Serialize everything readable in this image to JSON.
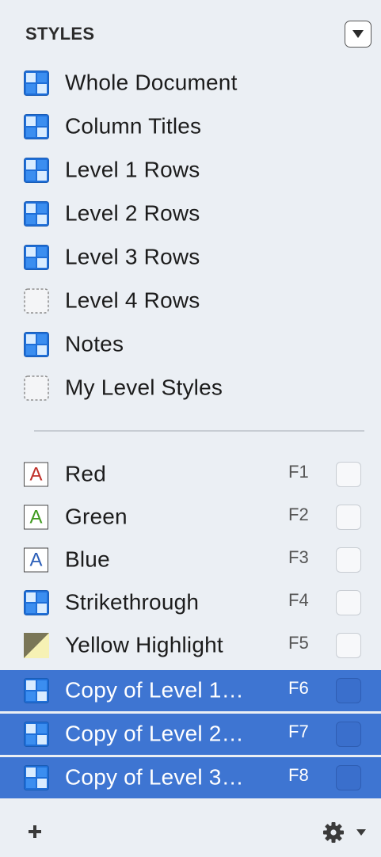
{
  "header": {
    "title": "STYLES",
    "menu_icon": "triangle-down-icon"
  },
  "level_styles": [
    {
      "label": "Whole Document",
      "icon": "style-icon"
    },
    {
      "label": "Column Titles",
      "icon": "style-icon"
    },
    {
      "label": "Level 1 Rows",
      "icon": "style-icon"
    },
    {
      "label": "Level 2 Rows",
      "icon": "style-icon"
    },
    {
      "label": "Level 3 Rows",
      "icon": "style-icon"
    },
    {
      "label": "Level 4 Rows",
      "icon": "empty-style-icon"
    },
    {
      "label": "Notes",
      "icon": "style-icon"
    },
    {
      "label": "My Level Styles",
      "icon": "empty-style-icon"
    }
  ],
  "named_styles": [
    {
      "label": "Red",
      "icon": "letter-a-icon",
      "glyph": "A",
      "glyph_color": "#c0302a",
      "key": "F1",
      "selected": false
    },
    {
      "label": "Green",
      "icon": "letter-a-icon",
      "glyph": "A",
      "glyph_color": "#3f9a1f",
      "key": "F2",
      "selected": false
    },
    {
      "label": "Blue",
      "icon": "letter-a-icon",
      "glyph": "A",
      "glyph_color": "#2c5fb8",
      "key": "F3",
      "selected": false
    },
    {
      "label": "Strikethrough",
      "icon": "style-icon",
      "key": "F4",
      "selected": false
    },
    {
      "label": "Yellow Highlight",
      "icon": "highlight-icon",
      "key": "F5",
      "selected": false
    },
    {
      "label": "Copy of Level 1…",
      "icon": "style-icon",
      "key": "F6",
      "selected": true
    },
    {
      "label": "Copy of Level 2…",
      "icon": "style-icon",
      "key": "F7",
      "selected": true
    },
    {
      "label": "Copy of Level 3…",
      "icon": "style-icon",
      "key": "F8",
      "selected": true
    }
  ],
  "footer": {
    "add_icon": "plus-icon",
    "settings_icon": "gear-icon"
  },
  "colors": {
    "panel_background": "#ebeff4",
    "selection": "#3e75d2",
    "style_icon_blue": "#2f7fe0"
  }
}
